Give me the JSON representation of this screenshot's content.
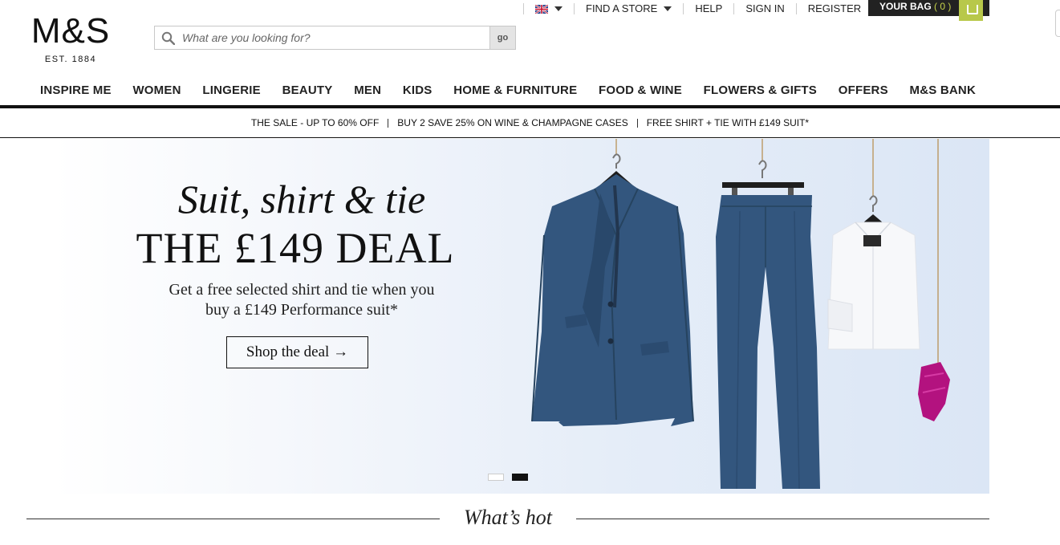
{
  "brand": {
    "logo": "M&S",
    "est": "EST. 1884"
  },
  "search": {
    "placeholder": "What are you looking for?",
    "button": "go"
  },
  "utility": {
    "find_store": "FIND A STORE",
    "help": "HELP",
    "sign_in": "SIGN IN",
    "register": "REGISTER",
    "bag_label": "YOUR BAG",
    "bag_count": "( 0 )"
  },
  "nav": [
    "INSPIRE ME",
    "WOMEN",
    "LINGERIE",
    "BEAUTY",
    "MEN",
    "KIDS",
    "HOME & FURNITURE",
    "FOOD & WINE",
    "FLOWERS & GIFTS",
    "OFFERS",
    "M&S BANK"
  ],
  "promos": [
    "THE SALE - UP TO 60% OFF",
    "BUY 2 SAVE 25% ON WINE & CHAMPAGNE CASES",
    "FREE SHIRT + TIE WITH £149 SUIT*"
  ],
  "hero": {
    "tagline": "Suit, shirt & tie",
    "title": "THE £149 DEAL",
    "desc_line1": "Get a free selected shirt and tie when you",
    "desc_line2": "buy a £149 Performance suit*",
    "cta": "Shop the deal →",
    "slides": 2,
    "active_slide": 2
  },
  "section": {
    "whats_hot": "What’s hot"
  },
  "colors": {
    "accent": "#b8c84a",
    "suit": "#34577c",
    "tie": "#b3127f"
  }
}
